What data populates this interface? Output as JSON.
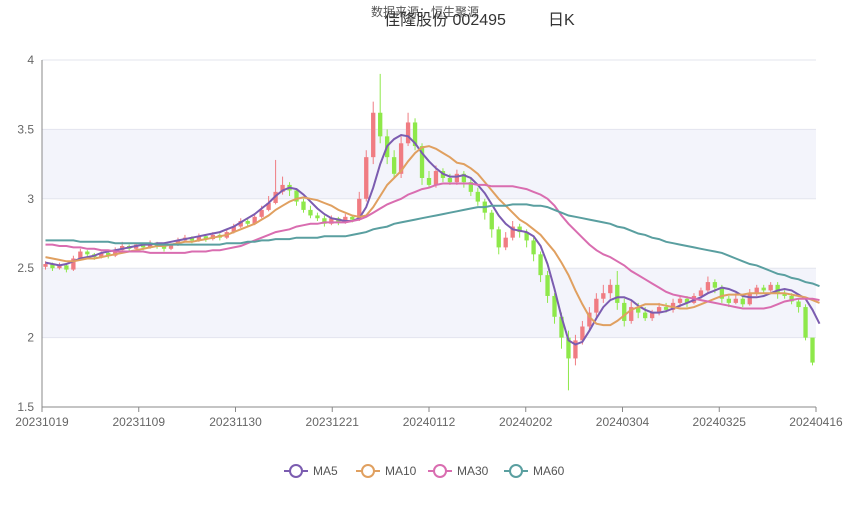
{
  "chart_data": {
    "type": "candlestick",
    "title": "佳隆股份 002495",
    "title_suffix": "日K",
    "subtitle": "数据来源：恒生聚源",
    "ylim": [
      1.5,
      4
    ],
    "y_ticks": [
      "1.5",
      "2",
      "2.5",
      "3",
      "3.5",
      "4"
    ],
    "x_ticks": [
      "20231019",
      "20231109",
      "20231130",
      "20231221",
      "20240112",
      "20240202",
      "20240304",
      "20240325",
      "20240416"
    ],
    "colors": {
      "up": "#f07c82",
      "down": "#8ee84a",
      "MA5": "#7b5cb0",
      "MA10": "#e0a060",
      "MA30": "#d96db0",
      "MA60": "#5a9fa0"
    },
    "candles": [
      [
        2.51,
        2.53,
        2.49,
        2.55
      ],
      [
        2.53,
        2.5,
        2.48,
        2.54
      ],
      [
        2.5,
        2.52,
        2.49,
        2.54
      ],
      [
        2.52,
        2.49,
        2.47,
        2.53
      ],
      [
        2.49,
        2.57,
        2.48,
        2.59
      ],
      [
        2.57,
        2.62,
        2.56,
        2.64
      ],
      [
        2.62,
        2.6,
        2.58,
        2.63
      ],
      [
        2.6,
        2.58,
        2.56,
        2.61
      ],
      [
        2.58,
        2.61,
        2.57,
        2.62
      ],
      [
        2.61,
        2.59,
        2.57,
        2.62
      ],
      [
        2.59,
        2.63,
        2.58,
        2.65
      ],
      [
        2.63,
        2.66,
        2.62,
        2.69
      ],
      [
        2.66,
        2.64,
        2.62,
        2.67
      ],
      [
        2.64,
        2.67,
        2.63,
        2.68
      ],
      [
        2.67,
        2.65,
        2.63,
        2.68
      ],
      [
        2.65,
        2.68,
        2.64,
        2.7
      ],
      [
        2.68,
        2.66,
        2.64,
        2.69
      ],
      [
        2.66,
        2.64,
        2.62,
        2.67
      ],
      [
        2.64,
        2.67,
        2.63,
        2.68
      ],
      [
        2.67,
        2.7,
        2.66,
        2.72
      ],
      [
        2.7,
        2.72,
        2.69,
        2.74
      ],
      [
        2.72,
        2.7,
        2.68,
        2.73
      ],
      [
        2.7,
        2.73,
        2.69,
        2.75
      ],
      [
        2.73,
        2.71,
        2.69,
        2.74
      ],
      [
        2.71,
        2.74,
        2.7,
        2.76
      ],
      [
        2.74,
        2.72,
        2.7,
        2.75
      ],
      [
        2.72,
        2.76,
        2.71,
        2.78
      ],
      [
        2.76,
        2.8,
        2.75,
        2.82
      ],
      [
        2.8,
        2.84,
        2.79,
        2.86
      ],
      [
        2.84,
        2.82,
        2.8,
        2.86
      ],
      [
        2.82,
        2.87,
        2.81,
        2.89
      ],
      [
        2.87,
        2.92,
        2.86,
        2.95
      ],
      [
        2.92,
        2.97,
        2.91,
        3.02
      ],
      [
        2.97,
        3.05,
        2.96,
        3.28
      ],
      [
        3.05,
        3.1,
        3.03,
        3.16
      ],
      [
        3.1,
        3.06,
        3.02,
        3.12
      ],
      [
        3.06,
        2.98,
        2.95,
        3.07
      ],
      [
        2.98,
        2.92,
        2.9,
        3.0
      ],
      [
        2.92,
        2.88,
        2.86,
        2.95
      ],
      [
        2.88,
        2.86,
        2.84,
        2.9
      ],
      [
        2.86,
        2.82,
        2.8,
        2.88
      ],
      [
        2.82,
        2.86,
        2.81,
        2.88
      ],
      [
        2.86,
        2.83,
        2.81,
        2.87
      ],
      [
        2.83,
        2.87,
        2.82,
        2.89
      ],
      [
        2.87,
        2.85,
        2.83,
        2.88
      ],
      [
        2.85,
        3.0,
        2.84,
        3.05
      ],
      [
        3.0,
        3.3,
        2.98,
        3.35
      ],
      [
        3.3,
        3.62,
        3.25,
        3.7
      ],
      [
        3.62,
        3.45,
        3.4,
        3.9
      ],
      [
        3.45,
        3.3,
        3.25,
        3.5
      ],
      [
        3.3,
        3.18,
        3.15,
        3.35
      ],
      [
        3.18,
        3.4,
        3.15,
        3.45
      ],
      [
        3.4,
        3.55,
        3.38,
        3.62
      ],
      [
        3.55,
        3.38,
        3.35,
        3.58
      ],
      [
        3.38,
        3.15,
        3.1,
        3.4
      ],
      [
        3.15,
        3.1,
        3.08,
        3.2
      ],
      [
        3.1,
        3.2,
        3.08,
        3.24
      ],
      [
        3.2,
        3.15,
        3.12,
        3.22
      ],
      [
        3.15,
        3.12,
        3.1,
        3.18
      ],
      [
        3.12,
        3.18,
        3.1,
        3.21
      ],
      [
        3.18,
        3.12,
        3.08,
        3.2
      ],
      [
        3.12,
        3.05,
        3.02,
        3.15
      ],
      [
        3.05,
        2.98,
        2.95,
        3.08
      ],
      [
        2.98,
        2.9,
        2.85,
        3.0
      ],
      [
        2.9,
        2.78,
        2.72,
        2.92
      ],
      [
        2.78,
        2.65,
        2.6,
        2.8
      ],
      [
        2.65,
        2.72,
        2.63,
        2.76
      ],
      [
        2.72,
        2.8,
        2.7,
        2.84
      ],
      [
        2.8,
        2.76,
        2.72,
        2.82
      ],
      [
        2.76,
        2.7,
        2.65,
        2.78
      ],
      [
        2.7,
        2.6,
        2.55,
        2.72
      ],
      [
        2.6,
        2.45,
        2.4,
        2.62
      ],
      [
        2.45,
        2.3,
        2.25,
        2.48
      ],
      [
        2.3,
        2.15,
        2.1,
        2.32
      ],
      [
        2.15,
        2.0,
        1.92,
        2.18
      ],
      [
        2.0,
        1.85,
        1.62,
        2.05
      ],
      [
        1.85,
        1.98,
        1.8,
        2.02
      ],
      [
        1.98,
        2.08,
        1.95,
        2.12
      ],
      [
        2.08,
        2.18,
        2.05,
        2.22
      ],
      [
        2.18,
        2.28,
        2.15,
        2.32
      ],
      [
        2.28,
        2.32,
        2.25,
        2.38
      ],
      [
        2.32,
        2.38,
        2.28,
        2.42
      ],
      [
        2.38,
        2.25,
        2.2,
        2.48
      ],
      [
        2.25,
        2.12,
        2.08,
        2.28
      ],
      [
        2.12,
        2.22,
        2.1,
        2.26
      ],
      [
        2.22,
        2.18,
        2.14,
        2.25
      ],
      [
        2.18,
        2.14,
        2.12,
        2.22
      ],
      [
        2.14,
        2.18,
        2.12,
        2.2
      ],
      [
        2.18,
        2.22,
        2.16,
        2.25
      ],
      [
        2.22,
        2.2,
        2.18,
        2.25
      ],
      [
        2.2,
        2.25,
        2.18,
        2.28
      ],
      [
        2.25,
        2.28,
        2.22,
        2.3
      ],
      [
        2.28,
        2.25,
        2.22,
        2.3
      ],
      [
        2.25,
        2.3,
        2.24,
        2.32
      ],
      [
        2.3,
        2.34,
        2.28,
        2.36
      ],
      [
        2.34,
        2.4,
        2.32,
        2.44
      ],
      [
        2.4,
        2.36,
        2.32,
        2.42
      ],
      [
        2.36,
        2.28,
        2.25,
        2.38
      ],
      [
        2.28,
        2.25,
        2.22,
        2.3
      ],
      [
        2.25,
        2.28,
        2.24,
        2.32
      ],
      [
        2.28,
        2.24,
        2.22,
        2.3
      ],
      [
        2.24,
        2.32,
        2.23,
        2.35
      ],
      [
        2.32,
        2.36,
        2.3,
        2.38
      ],
      [
        2.36,
        2.34,
        2.32,
        2.38
      ],
      [
        2.34,
        2.38,
        2.33,
        2.4
      ],
      [
        2.38,
        2.32,
        2.28,
        2.4
      ],
      [
        2.32,
        2.3,
        2.28,
        2.34
      ],
      [
        2.3,
        2.26,
        2.24,
        2.32
      ],
      [
        2.26,
        2.22,
        2.18,
        2.28
      ],
      [
        2.22,
        2.0,
        1.98,
        2.24
      ],
      [
        2.0,
        1.82,
        1.8,
        1.9
      ]
    ],
    "series": [
      {
        "name": "MA5",
        "values": [
          2.54,
          2.53,
          2.52,
          2.53,
          2.55,
          2.57,
          2.58,
          2.59,
          2.61,
          2.62,
          2.63,
          2.64,
          2.65,
          2.66,
          2.67,
          2.67,
          2.68,
          2.68,
          2.69,
          2.7,
          2.71,
          2.72,
          2.73,
          2.74,
          2.75,
          2.76,
          2.78,
          2.8,
          2.83,
          2.86,
          2.89,
          2.93,
          2.97,
          3.02,
          3.06,
          3.08,
          3.07,
          3.03,
          2.98,
          2.93,
          2.89,
          2.86,
          2.85,
          2.84,
          2.84,
          2.86,
          2.94,
          3.08,
          3.25,
          3.38,
          3.43,
          3.46,
          3.45,
          3.4,
          3.33,
          3.27,
          3.22,
          3.18,
          3.16,
          3.16,
          3.17,
          3.15,
          3.1,
          3.04,
          2.96,
          2.88,
          2.82,
          2.78,
          2.77,
          2.76,
          2.73,
          2.66,
          2.53,
          2.35,
          2.15,
          1.98,
          1.95,
          1.97,
          2.05,
          2.14,
          2.22,
          2.27,
          2.29,
          2.29,
          2.27,
          2.23,
          2.2,
          2.18,
          2.18,
          2.19,
          2.21,
          2.23,
          2.25,
          2.27,
          2.29,
          2.32,
          2.34,
          2.36,
          2.35,
          2.33,
          2.3,
          2.29,
          2.29,
          2.3,
          2.32,
          2.34,
          2.35,
          2.34,
          2.31,
          2.28,
          2.2,
          2.1
        ]
      },
      {
        "name": "MA10",
        "values": [
          2.58,
          2.57,
          2.56,
          2.55,
          2.55,
          2.56,
          2.57,
          2.57,
          2.58,
          2.59,
          2.6,
          2.61,
          2.62,
          2.63,
          2.64,
          2.65,
          2.66,
          2.66,
          2.67,
          2.68,
          2.69,
          2.69,
          2.7,
          2.71,
          2.72,
          2.73,
          2.74,
          2.76,
          2.78,
          2.8,
          2.82,
          2.85,
          2.88,
          2.92,
          2.95,
          2.98,
          3.0,
          3.01,
          3.0,
          2.99,
          2.97,
          2.95,
          2.92,
          2.9,
          2.88,
          2.87,
          2.88,
          2.94,
          3.02,
          3.1,
          3.15,
          3.2,
          3.27,
          3.33,
          3.37,
          3.38,
          3.36,
          3.33,
          3.3,
          3.26,
          3.25,
          3.22,
          3.18,
          3.12,
          3.06,
          3.0,
          2.95,
          2.9,
          2.85,
          2.82,
          2.78,
          2.74,
          2.68,
          2.62,
          2.54,
          2.45,
          2.34,
          2.24,
          2.15,
          2.1,
          2.09,
          2.09,
          2.12,
          2.16,
          2.2,
          2.22,
          2.24,
          2.24,
          2.24,
          2.23,
          2.22,
          2.21,
          2.21,
          2.22,
          2.24,
          2.26,
          2.28,
          2.3,
          2.31,
          2.31,
          2.31,
          2.32,
          2.32,
          2.32,
          2.32,
          2.32,
          2.32,
          2.31,
          2.3,
          2.29,
          2.27,
          2.25
        ]
      },
      {
        "name": "MA30",
        "values": [
          2.67,
          2.67,
          2.66,
          2.66,
          2.65,
          2.65,
          2.64,
          2.64,
          2.63,
          2.63,
          2.62,
          2.62,
          2.62,
          2.62,
          2.62,
          2.61,
          2.61,
          2.61,
          2.61,
          2.61,
          2.61,
          2.62,
          2.62,
          2.62,
          2.63,
          2.63,
          2.64,
          2.65,
          2.66,
          2.68,
          2.7,
          2.72,
          2.74,
          2.76,
          2.77,
          2.78,
          2.8,
          2.81,
          2.82,
          2.82,
          2.83,
          2.83,
          2.83,
          2.83,
          2.84,
          2.85,
          2.87,
          2.9,
          2.93,
          2.96,
          2.98,
          3.0,
          3.03,
          3.05,
          3.07,
          3.08,
          3.1,
          3.11,
          3.11,
          3.11,
          3.11,
          3.11,
          3.1,
          3.1,
          3.09,
          3.09,
          3.09,
          3.09,
          3.08,
          3.07,
          3.05,
          3.03,
          3.0,
          2.95,
          2.88,
          2.82,
          2.77,
          2.72,
          2.67,
          2.63,
          2.6,
          2.58,
          2.55,
          2.52,
          2.48,
          2.45,
          2.42,
          2.39,
          2.36,
          2.33,
          2.31,
          2.3,
          2.29,
          2.28,
          2.27,
          2.26,
          2.25,
          2.24,
          2.23,
          2.22,
          2.21,
          2.21,
          2.21,
          2.21,
          2.22,
          2.24,
          2.26,
          2.27,
          2.28,
          2.28,
          2.28,
          2.27
        ]
      },
      {
        "name": "MA60",
        "values": [
          2.7,
          2.7,
          2.7,
          2.7,
          2.7,
          2.69,
          2.69,
          2.69,
          2.69,
          2.69,
          2.68,
          2.68,
          2.68,
          2.68,
          2.68,
          2.68,
          2.67,
          2.67,
          2.67,
          2.67,
          2.67,
          2.67,
          2.67,
          2.67,
          2.67,
          2.67,
          2.68,
          2.68,
          2.68,
          2.69,
          2.69,
          2.7,
          2.7,
          2.71,
          2.71,
          2.71,
          2.72,
          2.72,
          2.72,
          2.72,
          2.73,
          2.73,
          2.73,
          2.73,
          2.74,
          2.75,
          2.76,
          2.78,
          2.79,
          2.8,
          2.82,
          2.83,
          2.84,
          2.85,
          2.86,
          2.87,
          2.88,
          2.89,
          2.9,
          2.91,
          2.92,
          2.93,
          2.94,
          2.94,
          2.95,
          2.95,
          2.95,
          2.96,
          2.96,
          2.96,
          2.95,
          2.95,
          2.94,
          2.92,
          2.9,
          2.88,
          2.87,
          2.86,
          2.85,
          2.84,
          2.83,
          2.82,
          2.8,
          2.79,
          2.77,
          2.75,
          2.74,
          2.72,
          2.71,
          2.69,
          2.68,
          2.67,
          2.66,
          2.65,
          2.64,
          2.63,
          2.62,
          2.61,
          2.59,
          2.57,
          2.55,
          2.53,
          2.52,
          2.5,
          2.48,
          2.46,
          2.45,
          2.43,
          2.42,
          2.4,
          2.39,
          2.37
        ]
      }
    ]
  }
}
